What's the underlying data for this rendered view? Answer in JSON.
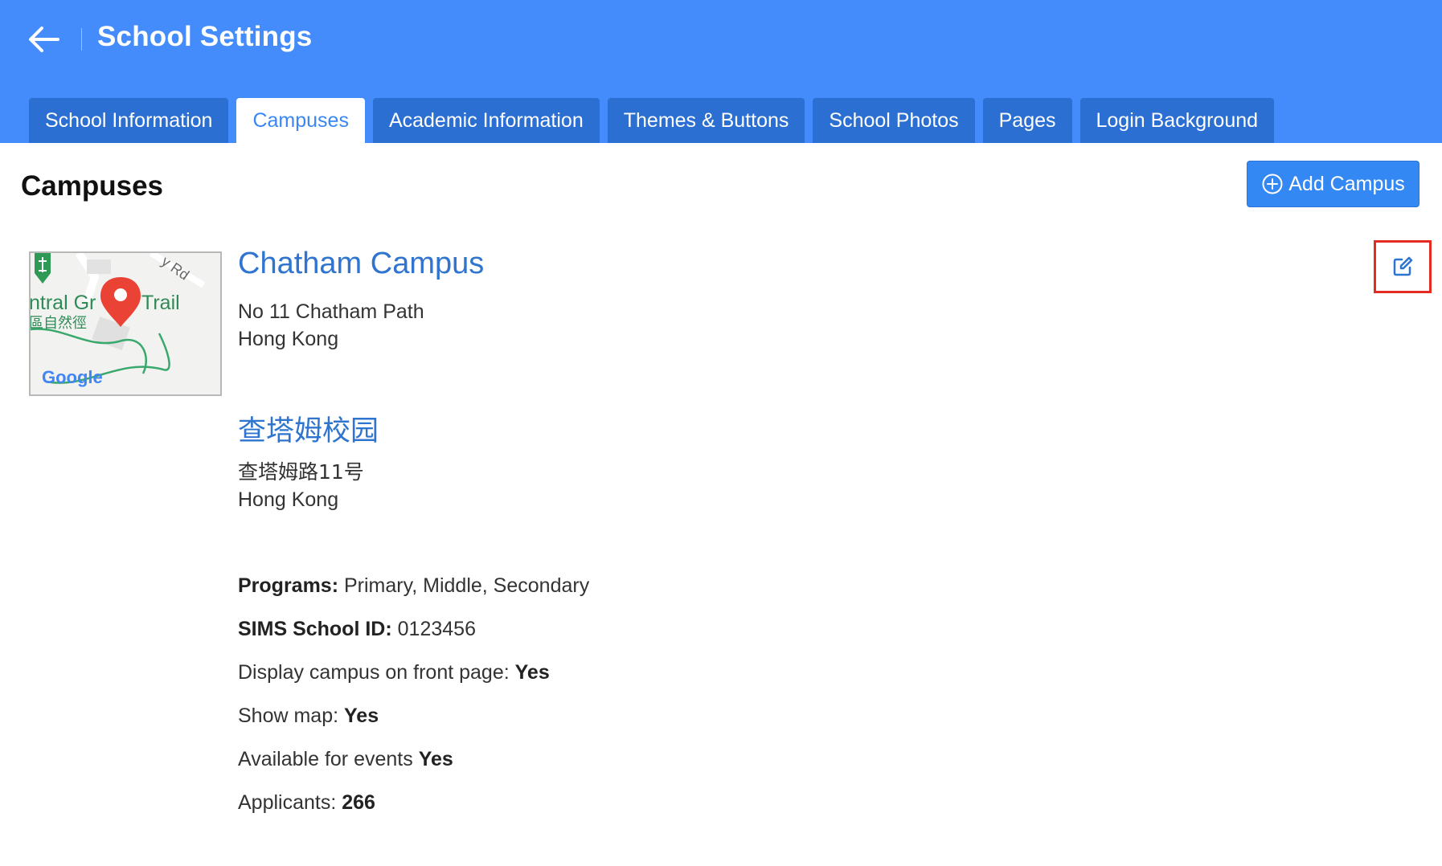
{
  "header": {
    "title": "School Settings",
    "back_icon": "arrow-left-icon"
  },
  "tabs": [
    {
      "label": "School Information",
      "active": false
    },
    {
      "label": "Campuses",
      "active": true
    },
    {
      "label": "Academic Information",
      "active": false
    },
    {
      "label": "Themes & Buttons",
      "active": false
    },
    {
      "label": "School Photos",
      "active": false
    },
    {
      "label": "Pages",
      "active": false
    },
    {
      "label": "Login Background",
      "active": false
    }
  ],
  "section": {
    "title": "Campuses",
    "add_button_label": "Add Campus",
    "add_icon": "plus-circle-icon",
    "edit_icon": "edit-icon"
  },
  "map": {
    "label_trail": "ntral Gr",
    "label_trail2": "Trail",
    "label_road": "y Rd",
    "label_chinese": "區自然徑",
    "google_logo": "Google"
  },
  "campus": {
    "name_en": "Chatham Campus",
    "address_en_line1": "No 11 Chatham Path",
    "address_en_line2": "Hong Kong",
    "name_zh": "查塔姆校园",
    "address_zh_line1": "查塔姆路11号",
    "address_zh_line2": "Hong Kong"
  },
  "details": {
    "programs_label": "Programs:",
    "programs_value": "Primary, Middle, Secondary",
    "sims_label": "SIMS School ID:",
    "sims_value": "0123456",
    "display_label": "Display campus on front page:",
    "display_value": "Yes",
    "map_label": "Show map:",
    "map_value": "Yes",
    "events_label": "Available for events",
    "events_value": "Yes",
    "applicants_label": "Applicants:",
    "applicants_value": "266"
  },
  "colors": {
    "header_bg": "#448cfb",
    "tab_bg": "#2b6fd3",
    "link_blue": "#2f74cf",
    "highlight_red": "#e32d22"
  }
}
